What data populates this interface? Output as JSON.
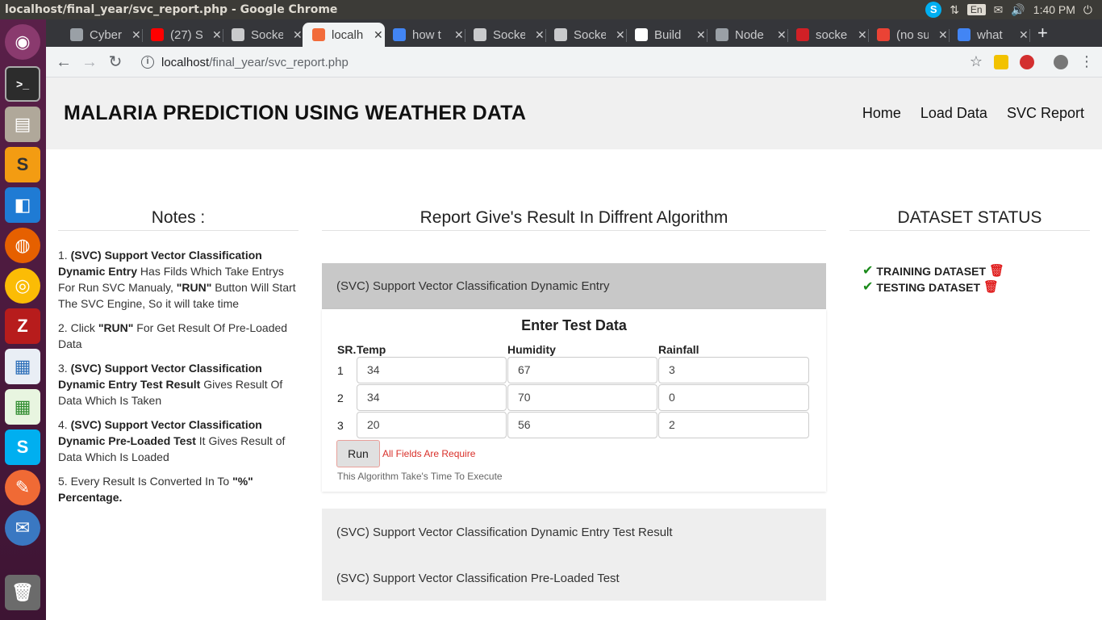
{
  "os": {
    "window_title": "localhost/final_year/svc_report.php - Google Chrome",
    "lang": "En",
    "time": "1:40 PM",
    "tray_icons": [
      "skype-icon",
      "network-arrows-icon",
      "mail-icon",
      "volume-icon",
      "power-icon"
    ]
  },
  "browser": {
    "tabs": [
      {
        "label": "Cyber",
        "fav": "#9aa0a6"
      },
      {
        "label": "(27) S",
        "fav": "#ff0000"
      },
      {
        "label": "Socke",
        "fav": "#c9cacc"
      },
      {
        "label": "localh",
        "fav": "#f26b3a",
        "active": true
      },
      {
        "label": "how t",
        "fav": "#4285f4"
      },
      {
        "label": "Socke",
        "fav": "#c9cacc"
      },
      {
        "label": "Socke",
        "fav": "#c9cacc"
      },
      {
        "label": "Build",
        "fav": "#ffffff"
      },
      {
        "label": "Node",
        "fav": "#9aa0a6"
      },
      {
        "label": "socke",
        "fav": "#d12026"
      },
      {
        "label": "(no su",
        "fav": "#ea4335"
      },
      {
        "label": "what",
        "fav": "#4285f4"
      }
    ],
    "url_host": "localhost",
    "url_path": "/final_year/svc_report.php"
  },
  "header": {
    "brand": "MALARIA PREDICTION USING WEATHER DATA",
    "nav": [
      "Home",
      "Load Data",
      "SVC Report"
    ]
  },
  "notes": {
    "title": "Notes :",
    "items": [
      {
        "num": "1.",
        "bold": "(SVC) Support Vector Classification Dynamic Entry",
        "text": " Has Filds Which Take Entrys For Run SVC Manualy, ",
        "bold2": "\"RUN\"",
        "text2": " Button Will Start The SVC Engine, So it will take time"
      },
      {
        "num": "2.",
        "pre": "Click ",
        "bold": "\"RUN\"",
        "text": " For Get Result Of Pre-Loaded Data"
      },
      {
        "num": "3.",
        "bold": "(SVC) Support Vector Classification Dynamic Entry Test Result",
        "text": " Gives Result Of Data Which Is Taken"
      },
      {
        "num": "4.",
        "bold": "(SVC) Support Vector Classification Dynamic Pre-Loaded Test",
        "text": " It Gives Result of Data Which Is Loaded"
      },
      {
        "num": "5.",
        "pre": "Every Result Is Converted In To ",
        "bold": "\"%\" Percentage."
      }
    ]
  },
  "report": {
    "title": "Report Give's Result In Diffrent Algorithm",
    "panel1_title": "(SVC) Support Vector Classification Dynamic Entry",
    "form_title": "Enter Test Data",
    "columns": [
      "SR.",
      "Temp",
      "Humidity",
      "Rainfall"
    ],
    "rows": [
      {
        "sr": "1",
        "temp": "34",
        "humidity": "67",
        "rainfall": "3"
      },
      {
        "sr": "2",
        "temp": "34",
        "humidity": "70",
        "rainfall": "0"
      },
      {
        "sr": "3",
        "temp": "20",
        "humidity": "56",
        "rainfall": "2"
      }
    ],
    "run_label": "Run",
    "required_msg": "All Fields Are Require",
    "exec_note": "This Algorithm Take's Time To Execute",
    "panel2_title": "(SVC) Support Vector Classification Dynamic Entry Test Result",
    "panel3_title": "(SVC) Support Vector Classification Pre-Loaded Test"
  },
  "dataset": {
    "title": "DATASET STATUS",
    "items": [
      "TRAINING DATASET",
      "TESTING DATASET"
    ]
  }
}
